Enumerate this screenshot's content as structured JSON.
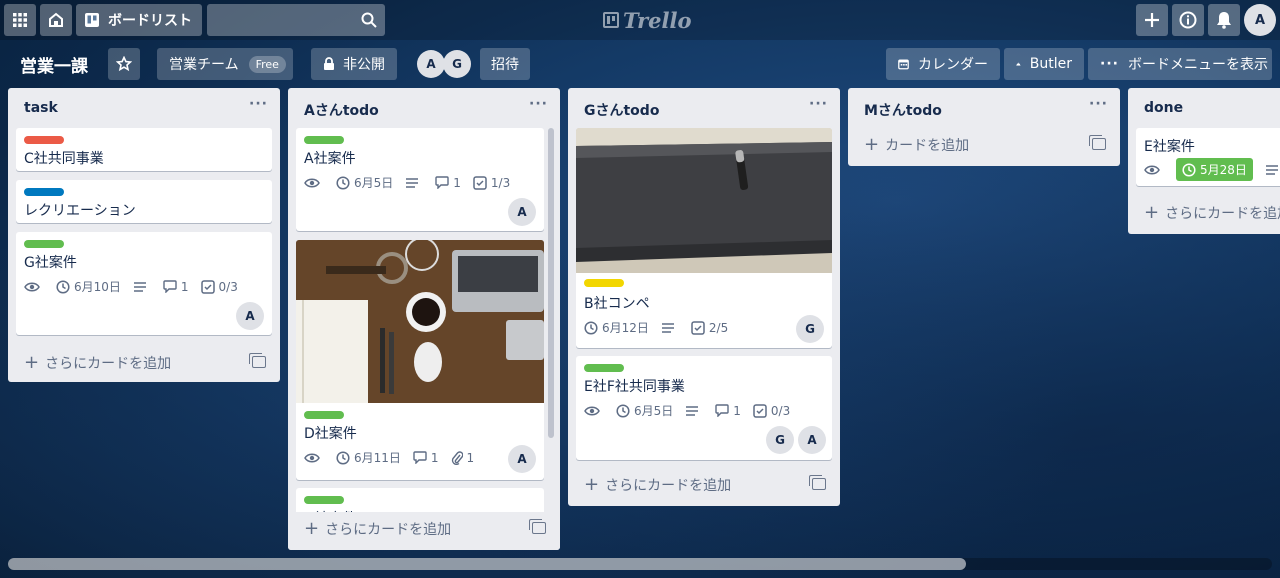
{
  "topbar": {
    "boards_label": "ボードリスト",
    "search_placeholder": "",
    "logo_text": "Trello",
    "user_initial": "A"
  },
  "board": {
    "title": "営業一課",
    "team": "営業チーム",
    "team_badge": "Free",
    "visibility": "非公開",
    "members": [
      "A",
      "G"
    ],
    "invite": "招待",
    "calendar": "カレンダー",
    "butler": "Butler",
    "menu": "ボードメニューを表示"
  },
  "colors": {
    "label_red": "#eb5a46",
    "label_blue": "#0079bf",
    "label_green": "#61bd4f",
    "label_yellow": "#f2d600",
    "due_green": "#61bd4f"
  },
  "add_card": "さらにカードを追加",
  "add_card_short": "カードを追加",
  "lists": [
    {
      "title": "task",
      "cards": [
        {
          "label": "red",
          "title": "C社共同事業"
        },
        {
          "label": "blue",
          "title": "レクリエーション"
        },
        {
          "label": "green",
          "title": "G社案件",
          "due": "6月10日",
          "comments": "1",
          "checklist": "0/3",
          "members": [
            "A"
          ]
        }
      ]
    },
    {
      "title": "Aさんtodo",
      "cards": [
        {
          "label": "green",
          "title": "A社案件",
          "due": "6月5日",
          "comments": "1",
          "checklist": "1/3",
          "members": [
            "A"
          ]
        },
        {
          "label": "green",
          "title": "D社案件",
          "cover": "desk-photo",
          "due": "6月11日",
          "comments": "1",
          "attachments": "1",
          "members": [
            "A"
          ]
        },
        {
          "label": "green",
          "title": "H社案件"
        }
      ]
    },
    {
      "title": "Gさんtodo",
      "cards": [
        {
          "label": "yellow",
          "title": "B社コンペ",
          "cover": "pen-photo",
          "due": "6月12日",
          "checklist": "2/5",
          "members": [
            "G"
          ]
        },
        {
          "label": "green",
          "title": "E社F社共同事業",
          "due": "6月5日",
          "comments": "1",
          "checklist": "0/3",
          "members": [
            "G",
            "A"
          ]
        }
      ]
    },
    {
      "title": "Mさんtodo",
      "cards": []
    },
    {
      "title": "done",
      "cards": [
        {
          "title": "E社案件",
          "due": "5月28日"
        }
      ]
    }
  ]
}
